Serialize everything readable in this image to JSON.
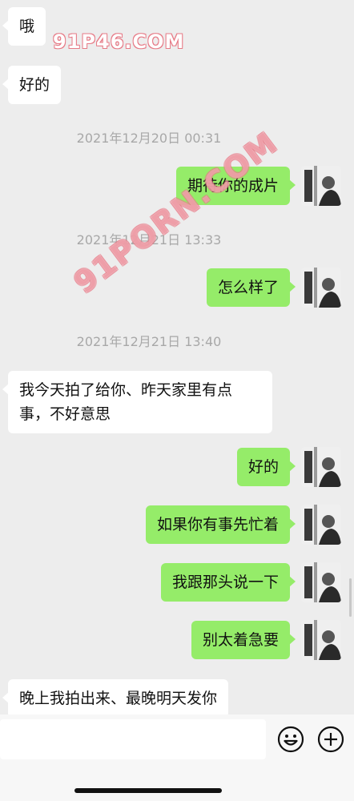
{
  "watermarks": {
    "top": "91P46.COM",
    "diagonal": "91PORN.COM"
  },
  "messages": [
    {
      "side": "left",
      "text": "哦"
    },
    {
      "side": "left",
      "text": "好的"
    },
    {
      "timestamp": "2021年12月20日 00:31"
    },
    {
      "side": "right",
      "text": "期待你的成片"
    },
    {
      "timestamp": "2021年12月21日 13:33"
    },
    {
      "side": "right",
      "text": "怎么样了"
    },
    {
      "timestamp": "2021年12月21日 13:40"
    },
    {
      "side": "left",
      "text": "我今天拍了给你、昨天家里有点事，不好意思"
    },
    {
      "side": "right",
      "text": "好的"
    },
    {
      "side": "right",
      "text": "如果你有事先忙着"
    },
    {
      "side": "right",
      "text": "我跟那头说一下"
    },
    {
      "side": "right",
      "text": "别太着急要"
    },
    {
      "side": "left",
      "text": "晚上我拍出来、最晚明天发你"
    }
  ],
  "input_bar": {
    "emoji_icon": "emoji-icon",
    "plus_icon": "plus-icon",
    "input_value": ""
  },
  "colors": {
    "background": "#ededed",
    "bubble_sent": "#95ec69",
    "bubble_received": "#ffffff",
    "timestamp_text": "#a8a8a8"
  }
}
